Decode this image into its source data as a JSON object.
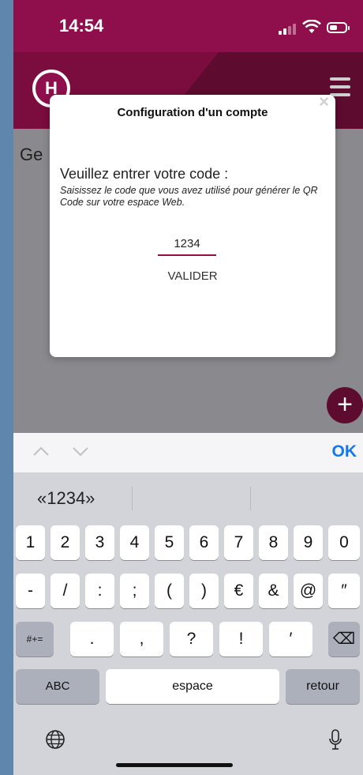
{
  "status_bar": {
    "time": "14:54"
  },
  "app": {
    "logo_letter": "H",
    "content_title": "Ge"
  },
  "dialog": {
    "title": "Configuration d'un compte",
    "close_label": "×",
    "prompt": "Veuillez entrer votre code :",
    "hint": "Saisissez le code que vous avez utilisé pour générer le QR Code sur votre espace Web.",
    "code_value": "1234",
    "validate_label": "VALIDER"
  },
  "fab_label": "+",
  "keyboard": {
    "toolbar": {
      "prev_label": "∧",
      "next_label": "∨",
      "done_label": "OK"
    },
    "suggestion": "«1234»",
    "row1": [
      "1",
      "2",
      "3",
      "4",
      "5",
      "6",
      "7",
      "8",
      "9",
      "0"
    ],
    "row2": [
      "-",
      "/",
      ":",
      ";",
      "(",
      ")",
      "€",
      "&",
      "@",
      "″"
    ],
    "row3": [
      ".",
      ",",
      "?",
      "!",
      "′"
    ],
    "symbols_label": "#+=",
    "delete_label": "⌫",
    "abc_label": "ABC",
    "space_label": "espace",
    "return_label": "retour",
    "globe_label": "🌐",
    "mic_label": "🎙"
  }
}
